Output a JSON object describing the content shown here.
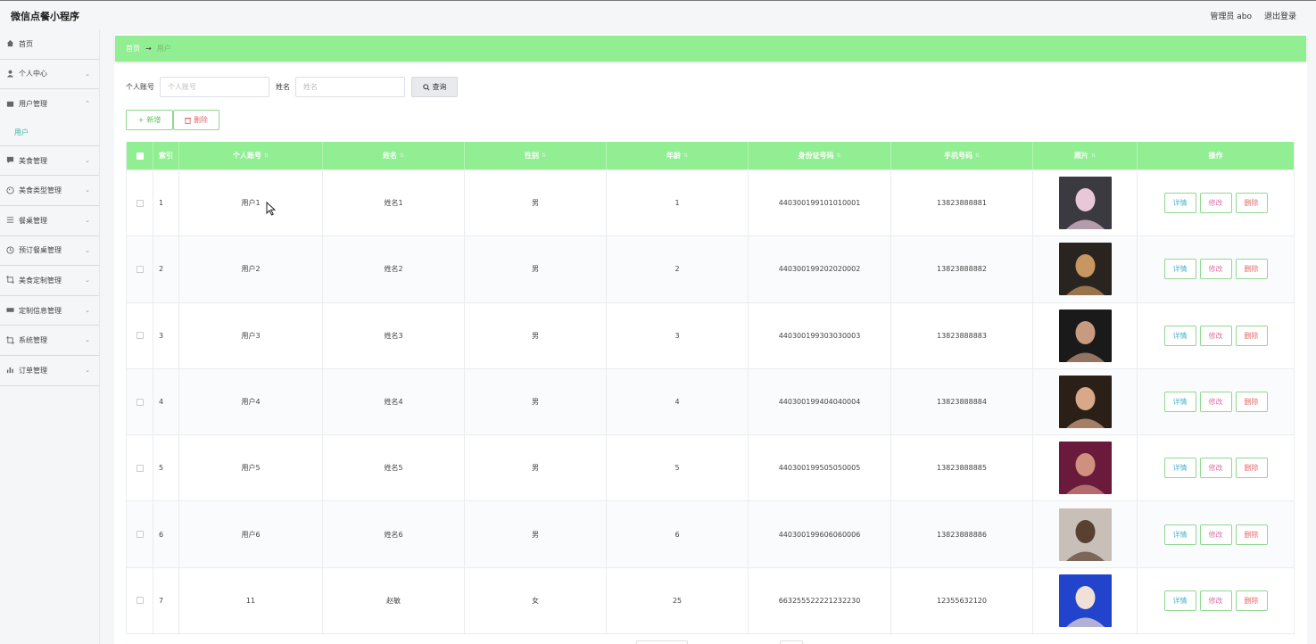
{
  "app": {
    "title": "微信点餐小程序"
  },
  "header": {
    "admin_label": "管理员 abo",
    "logout_label": "退出登录"
  },
  "sidebar": {
    "items": [
      {
        "label": "首页",
        "icon": "home-icon"
      },
      {
        "label": "个人中心",
        "icon": "user-icon"
      },
      {
        "label": "用户管理",
        "icon": "folder-icon",
        "open": true,
        "sub": [
          "用户"
        ]
      },
      {
        "label": "美食管理",
        "icon": "chat-icon"
      },
      {
        "label": "美食类型管理",
        "icon": "palette-icon"
      },
      {
        "label": "餐桌管理",
        "icon": "sliders-icon"
      },
      {
        "label": "预订餐桌管理",
        "icon": "clock-icon"
      },
      {
        "label": "美食定制管理",
        "icon": "crop-icon"
      },
      {
        "label": "定制信息管理",
        "icon": "ticket-icon"
      },
      {
        "label": "系统管理",
        "icon": "crop-icon"
      },
      {
        "label": "订单管理",
        "icon": "chart-icon"
      }
    ]
  },
  "breadcrumb": {
    "home": "首页",
    "separator": "→",
    "current": "用户"
  },
  "search": {
    "account_label": "个人账号",
    "account_placeholder": "个人账号",
    "name_label": "姓名",
    "name_placeholder": "姓名",
    "query_button": "查询"
  },
  "actions": {
    "add": "新增",
    "delete": "删除"
  },
  "table": {
    "columns": [
      "索引",
      "个人账号",
      "姓名",
      "性别",
      "年龄",
      "身份证号码",
      "手机号码",
      "照片",
      "操作"
    ],
    "row_buttons": {
      "detail": "详情",
      "edit": "修改",
      "delete": "删除"
    },
    "rows": [
      {
        "index": "1",
        "account": "用户1",
        "name": "姓名1",
        "sex": "男",
        "age": "1",
        "idcard": "440300199101010001",
        "phone": "13823888881",
        "photo_bg": "#3a3a40",
        "photo_fg": "#e8c8d8"
      },
      {
        "index": "2",
        "account": "用户2",
        "name": "姓名2",
        "sex": "男",
        "age": "2",
        "idcard": "440300199202020002",
        "phone": "13823888882",
        "photo_bg": "#2a2420",
        "photo_fg": "#c89660"
      },
      {
        "index": "3",
        "account": "用户3",
        "name": "姓名3",
        "sex": "男",
        "age": "3",
        "idcard": "440300199303030003",
        "phone": "13823888883",
        "photo_bg": "#1a1a1a",
        "photo_fg": "#c89a80"
      },
      {
        "index": "4",
        "account": "用户4",
        "name": "姓名4",
        "sex": "男",
        "age": "4",
        "idcard": "440300199404040004",
        "phone": "13823888884",
        "photo_bg": "#2a2018",
        "photo_fg": "#d8a888"
      },
      {
        "index": "5",
        "account": "用户5",
        "name": "姓名5",
        "sex": "男",
        "age": "5",
        "idcard": "440300199505050005",
        "phone": "13823888885",
        "photo_bg": "#6a1a3a",
        "photo_fg": "#d09080"
      },
      {
        "index": "6",
        "account": "用户6",
        "name": "姓名6",
        "sex": "男",
        "age": "6",
        "idcard": "440300199606060006",
        "phone": "13823888886",
        "photo_bg": "#c8c0b8",
        "photo_fg": "#5a4030"
      },
      {
        "index": "7",
        "account": "11",
        "name": "赵敏",
        "sex": "女",
        "age": "25",
        "idcard": "663255522221232230",
        "phone": "12355632120",
        "photo_bg": "#2244cc",
        "photo_fg": "#f0e0d8"
      }
    ]
  },
  "colors": {
    "accent_green": "#92ee92",
    "teal": "#3cb5a6"
  }
}
